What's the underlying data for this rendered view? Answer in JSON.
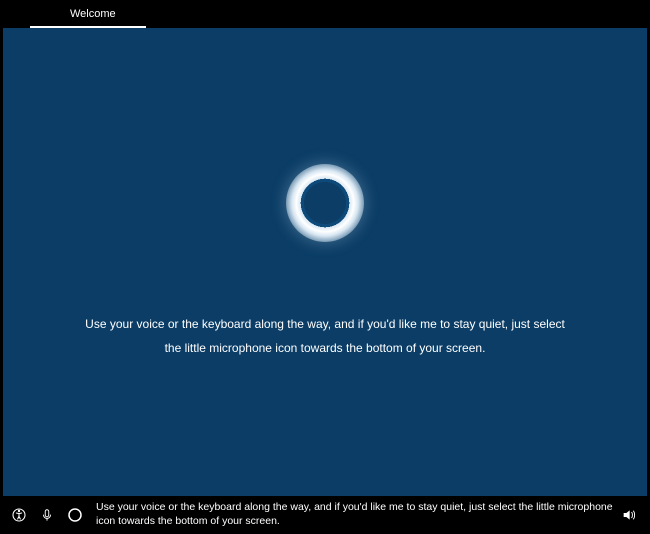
{
  "tab": {
    "label": "Welcome"
  },
  "main": {
    "instruction": "Use your voice or the keyboard along the way, and if you'd like me to stay quiet, just select the little microphone icon towards the bottom of your screen."
  },
  "bottombar": {
    "caption": "Use your voice or the keyboard along the way, and if you'd like me to stay quiet, just select the little microphone icon towards the bottom of your screen.",
    "icons": {
      "accessibility": "accessibility-icon",
      "microphone": "microphone-icon",
      "cortana": "cortana-icon",
      "volume": "volume-icon"
    }
  },
  "colors": {
    "background": "#0b3d66",
    "black": "#000000",
    "white": "#ffffff"
  }
}
